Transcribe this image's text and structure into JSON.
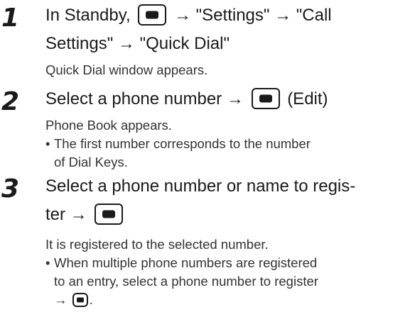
{
  "steps": [
    {
      "number": "1",
      "line1": {
        "prefix": "In Standby,",
        "suffix": "→ \"Settings\" → \"Call"
      },
      "line2": "Settings\" → \"Quick Dial\"",
      "desc": "Quick Dial window appears."
    },
    {
      "number": "2",
      "line1": {
        "prefix": "Select a phone number →",
        "suffix": "(Edit)"
      },
      "desc": "Phone Book appears.",
      "bullet": {
        "dot": "•",
        "line1": "The first number corresponds to the number",
        "line2": "of Dial Keys."
      }
    },
    {
      "number": "3",
      "line1": "Select a phone number or name to regis-",
      "line2": {
        "prefix": "ter →"
      },
      "desc": "It is registered to the selected number.",
      "bullet": {
        "dot": "•",
        "line1": "When multiple phone numbers are registered",
        "line2": "to an entry, select a phone number to register",
        "line3": {
          "prefix": "→",
          "suffix": "."
        }
      }
    }
  ],
  "icons": {
    "center_key": "center-key-icon"
  }
}
